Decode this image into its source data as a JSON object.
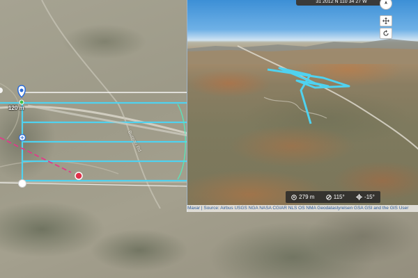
{
  "map2d": {
    "altitude_label": "120 m",
    "road_label": "Bureau Rd"
  },
  "view3d": {
    "header_readout": "31 2012   N 110 34 27   W",
    "stats": {
      "altitude": "279 m",
      "heading": "115°",
      "tilt": "-15°"
    },
    "attribution": "Maxar | Source: Airbus USGS NGA NASA CGIAR NLS OS NMA Geodatastyrelsen GSA GSI and the GIS User"
  },
  "colors": {
    "route": "#4fd2f0",
    "waypoint_marker": "#2a6bd8",
    "target_point": "#e0304a",
    "dashed_path": "#e23a8a",
    "arc": "#4ef0c0"
  },
  "icons": [
    "compass-icon",
    "pan-icon",
    "rotate-icon",
    "altitude-icon",
    "heading-icon",
    "tilt-icon",
    "waypoint-pin-icon"
  ]
}
